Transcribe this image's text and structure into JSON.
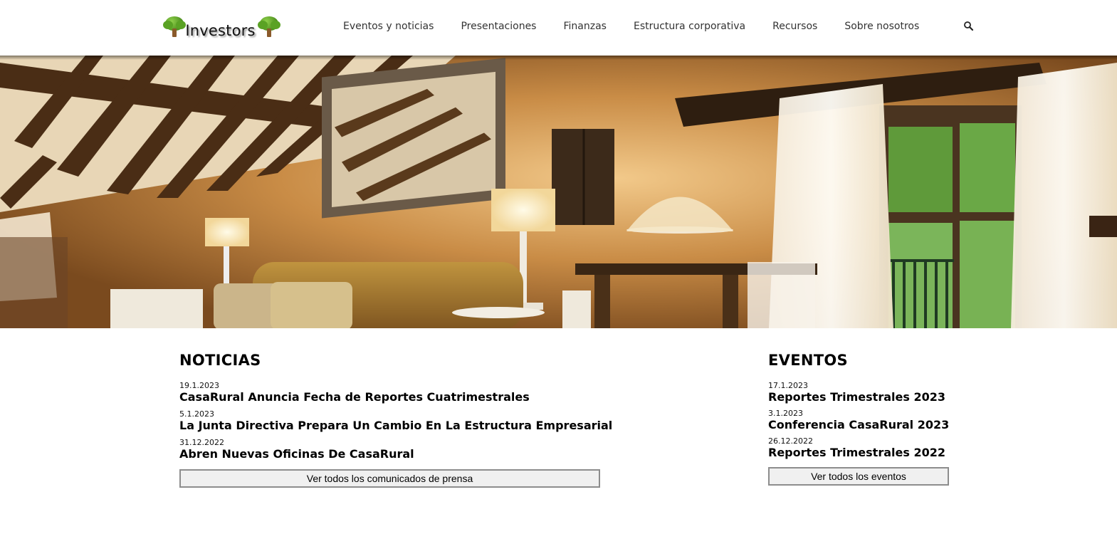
{
  "header": {
    "logo_text": "Investors",
    "nav": [
      {
        "label": "Eventos y noticias"
      },
      {
        "label": "Presentaciones"
      },
      {
        "label": "Finanzas"
      },
      {
        "label": "Estructura corporativa"
      },
      {
        "label": "Recursos"
      },
      {
        "label": "Sobre nosotros"
      }
    ],
    "search_icon": "search-icon"
  },
  "hero": {
    "image": "rustic-living-room-photo"
  },
  "news": {
    "title": "NOTICIAS",
    "items": [
      {
        "date": "19.1.2023",
        "title": "CasaRural Anuncia Fecha de Reportes Cuatrimestrales"
      },
      {
        "date": "5.1.2023",
        "title": "La Junta Directiva Prepara Un Cambio En La Estructura Empresarial"
      },
      {
        "date": "31.12.2022",
        "title": "Abren Nuevas Oficinas De CasaRural"
      }
    ],
    "button_label": "Ver todos los comunicados de prensa"
  },
  "events": {
    "title": "EVENTOS",
    "items": [
      {
        "date": "17.1.2023",
        "title": "Reportes Trimestrales 2023"
      },
      {
        "date": "3.1.2023",
        "title": "Conferencia CasaRural 2023"
      },
      {
        "date": "26.12.2022",
        "title": "Reportes Trimestrales 2022"
      }
    ],
    "button_label": "Ver todos los eventos"
  }
}
